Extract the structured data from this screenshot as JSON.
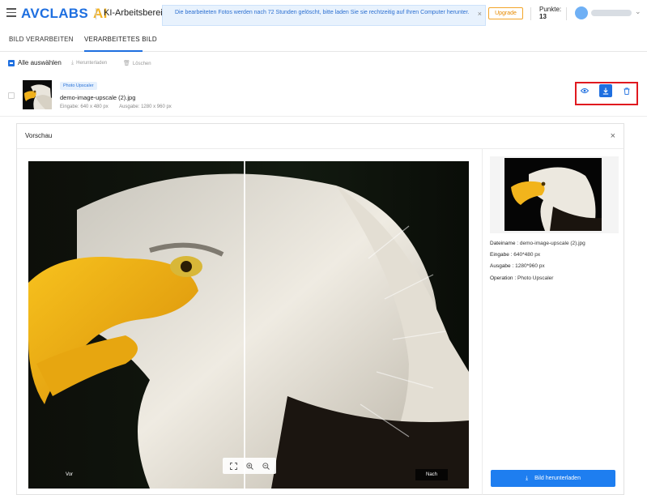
{
  "header": {
    "logo_main": "AVCLABS",
    "logo_ai": "AI",
    "workspace": "KI-Arbeitsbereich",
    "notice": "Die bearbeiteten Fotos werden nach 72 Stunden gelöscht, bitte laden Sie sie rechtzeitig auf Ihren Computer herunter.",
    "notice_close": "×",
    "upgrade_label": "Upgrade",
    "points_label": "Punkte:",
    "points_value": "13",
    "chevron": "⌄"
  },
  "tabs": [
    {
      "label": "BILD VERARBEITEN"
    },
    {
      "label": "VERARBEITETES BILD"
    }
  ],
  "toolbar": {
    "select_all": "Alle auswählen",
    "download": "Herunterladen",
    "delete": "Löschen"
  },
  "file": {
    "badge": "Photo Upscaler",
    "name": "demo-image-upscale (2).jpg",
    "input": "Eingabe: 640 x 480 px",
    "output": "Ausgabe: 1280 x 960 px"
  },
  "preview": {
    "title": "Vorschau",
    "close": "×",
    "label_before": "Vor",
    "label_after": "Nach",
    "meta": [
      {
        "key": "Dateiname :",
        "value": "demo-image-upscale (2).jpg"
      },
      {
        "key": "Eingabe :",
        "value": "640*480 px"
      },
      {
        "key": "Ausgabe :",
        "value": "1280*960 px"
      },
      {
        "key": "Operation :",
        "value": "Photo Upscaler"
      }
    ],
    "download_label": "Bild herunterladen"
  },
  "colors": {
    "brand_blue": "#1e6fe0",
    "ai_yellow": "#f3b325",
    "highlight_red": "#e0191f",
    "upgrade_orange": "#e68a00"
  },
  "icons": [
    "hamburger-icon",
    "close-icon",
    "download-icon",
    "trash-icon",
    "eye-icon",
    "fit-screen-icon",
    "zoom-in-icon",
    "zoom-out-icon",
    "chevron-down-icon"
  ]
}
